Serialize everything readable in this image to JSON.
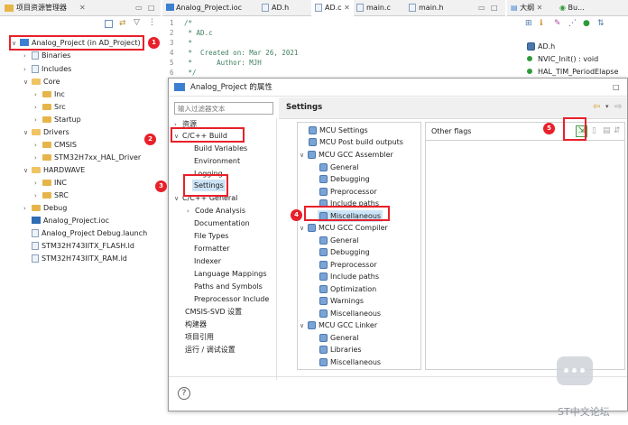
{
  "explorer": {
    "title": "项目资源管理器",
    "items": [
      {
        "label": "Analog_Project (in AD_Project)"
      },
      {
        "label": "Binaries"
      },
      {
        "label": "Includes"
      },
      {
        "label": "Core"
      },
      {
        "label": "Inc"
      },
      {
        "label": "Src"
      },
      {
        "label": "Startup"
      },
      {
        "label": "Drivers"
      },
      {
        "label": "CMSIS"
      },
      {
        "label": "STM32H7xx_HAL_Driver"
      },
      {
        "label": "HARDWAVE"
      },
      {
        "label": "INC"
      },
      {
        "label": "SRC"
      },
      {
        "label": "Debug"
      },
      {
        "label": "Analog_Project.ioc"
      },
      {
        "label": "Analog_Project Debug.launch"
      },
      {
        "label": "STM32H743IITX_FLASH.ld"
      },
      {
        "label": "STM32H743IITX_RAM.ld"
      }
    ]
  },
  "editor": {
    "tabs": [
      "Analog_Project.ioc",
      "AD.h",
      "AD.c",
      "main.c",
      "main.h"
    ],
    "lines": [
      {
        "n": "1",
        "text": "/*"
      },
      {
        "n": "2",
        "text": " * AD.c"
      },
      {
        "n": "3",
        "text": " *"
      },
      {
        "n": "4",
        "text": " *  Created on: Mar 26, 2021"
      },
      {
        "n": "5",
        "text": " *      Author: MJH"
      },
      {
        "n": "6",
        "text": " */"
      }
    ]
  },
  "outline": {
    "tabs": [
      "大纲",
      "Bu..."
    ],
    "items": [
      "AD.h",
      "NVIC_Init() : void",
      "HAL_TIM_PeriodElapse"
    ]
  },
  "dialog": {
    "title": "Analog_Project 的属性",
    "filter_placeholder": "输入过滤器文本",
    "categories": [
      "资源",
      "C/C++ Build",
      "Build Variables",
      "Environment",
      "Logging",
      "Settings",
      "C/C++ General",
      "Code Analysis",
      "Documentation",
      "File Types",
      "Formatter",
      "Indexer",
      "Language Mappings",
      "Paths and Symbols",
      "Preprocessor Include",
      "CMSIS-SVD 设置",
      "构建器",
      "项目引用",
      "运行 / 调试设置"
    ],
    "page_title": "Settings",
    "settings_tree": [
      "MCU Settings",
      "MCU Post build outputs",
      "MCU GCC Assembler",
      "General",
      "Debugging",
      "Preprocessor",
      "Include paths",
      "Miscellaneous",
      "MCU GCC Compiler",
      "General",
      "Debugging",
      "Preprocessor",
      "Include paths",
      "Optimization",
      "Warnings",
      "Miscellaneous",
      "MCU GCC Linker",
      "General",
      "Libraries",
      "Miscellaneous"
    ],
    "other_flags_label": "Other flags",
    "help_icon": "?"
  },
  "badges": [
    "1",
    "2",
    "3",
    "4",
    "5"
  ],
  "watermark": "ST中文论坛",
  "colors": {
    "highlight": "#e8202a",
    "selection": "#cde4f7"
  }
}
